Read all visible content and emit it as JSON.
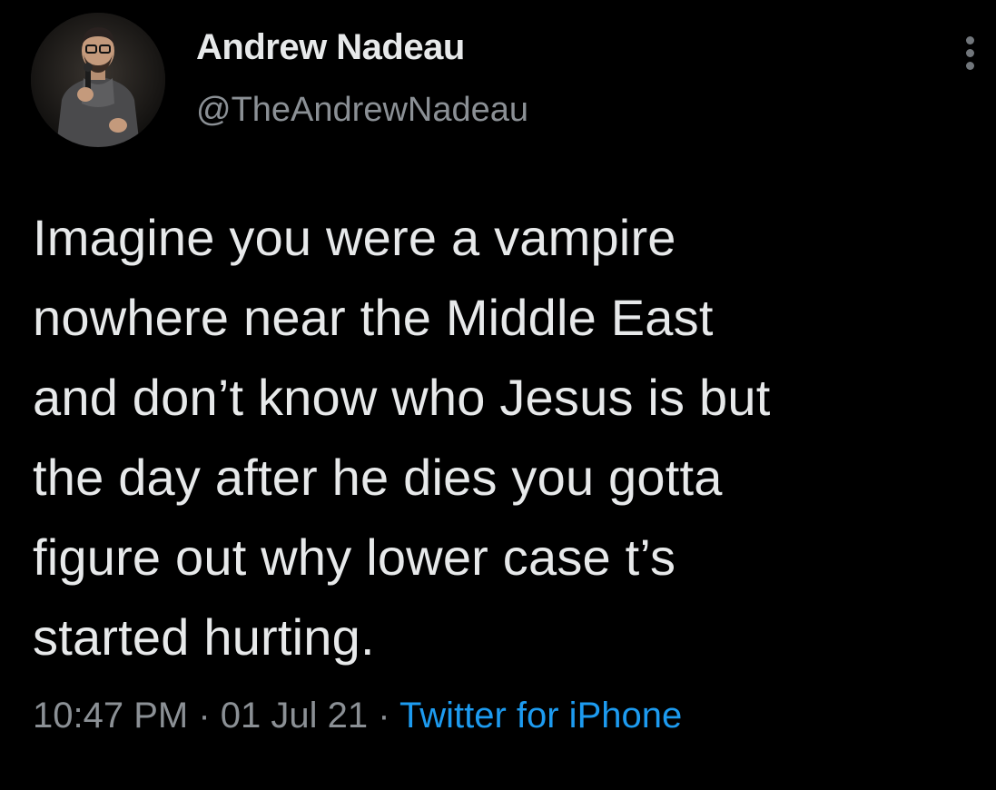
{
  "author": {
    "name": "Andrew Nadeau",
    "handle": "@TheAndrewNadeau",
    "avatar_icon": "profile-photo"
  },
  "tweet": {
    "lines": [
      "Imagine you were a vampire",
      "nowhere near the Middle East",
      "and don’t know who Jesus is but",
      "the day after he dies you gotta",
      "figure out why lower case t’s",
      "started hurting."
    ]
  },
  "meta": {
    "time": "10:47 PM",
    "separator": "·",
    "date": "01 Jul 21",
    "source": "Twitter for iPhone"
  },
  "icons": {
    "more": "more-vertical-icon"
  },
  "colors": {
    "background": "#000000",
    "primary_text": "#e7e9ea",
    "secondary_text": "#8b9095",
    "link": "#1d9bf0"
  }
}
